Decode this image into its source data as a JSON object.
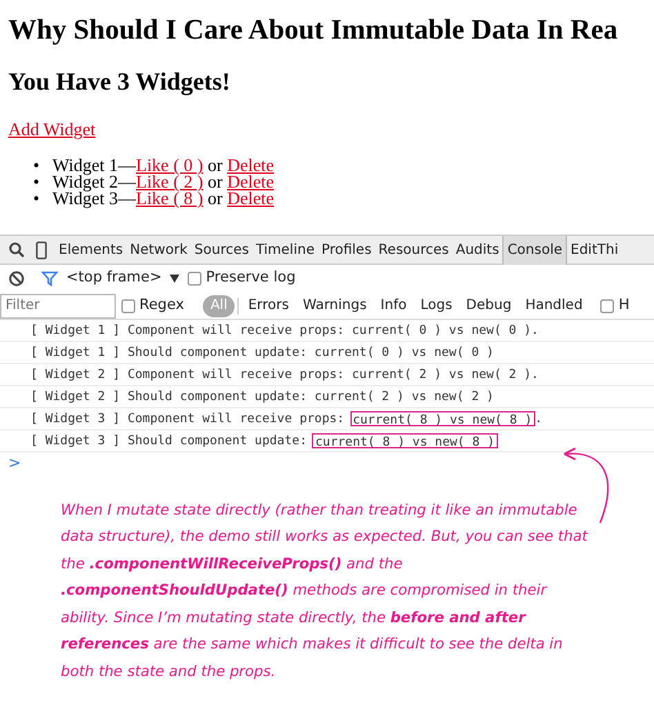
{
  "page": {
    "title": "Why Should I Care About Immutable Data In Rea",
    "subtitle": "You Have 3 Widgets!",
    "add_link": "Add Widget",
    "widgets": [
      {
        "marker": "•",
        "name": "Widget 1",
        "dash": "—",
        "like": "Like ( 0 )",
        "or": "or",
        "delete": "Delete"
      },
      {
        "marker": "•",
        "name": "Widget 2",
        "dash": "—",
        "like": "Like ( 2 )",
        "or": "or",
        "delete": "Delete"
      },
      {
        "marker": "•",
        "name": "Widget 3",
        "dash": "—",
        "like": "Like ( 8 )",
        "or": "or",
        "delete": "Delete"
      }
    ]
  },
  "devtools": {
    "tabs": [
      {
        "label": "Elements",
        "selected": false
      },
      {
        "label": "Network",
        "selected": false
      },
      {
        "label": "Sources",
        "selected": false
      },
      {
        "label": "Timeline",
        "selected": false
      },
      {
        "label": "Profiles",
        "selected": false
      },
      {
        "label": "Resources",
        "selected": false
      },
      {
        "label": "Audits",
        "selected": false
      },
      {
        "label": "Console",
        "selected": true
      },
      {
        "label": "EditThi",
        "selected": false
      }
    ],
    "frame_select": "<top frame>",
    "preserve_log": {
      "label": "Preserve log",
      "checked": false
    },
    "filter": {
      "placeholder": "Filter"
    },
    "regex": {
      "label": "Regex",
      "checked": false
    },
    "levels": [
      {
        "label": "All",
        "selected": true
      },
      {
        "label": "Errors",
        "selected": false
      },
      {
        "label": "Warnings",
        "selected": false
      },
      {
        "label": "Info",
        "selected": false
      },
      {
        "label": "Logs",
        "selected": false
      },
      {
        "label": "Debug",
        "selected": false
      },
      {
        "label": "Handled",
        "selected": false
      }
    ],
    "hidden_option": {
      "label": "H",
      "checked": false
    },
    "log": [
      {
        "parts": [
          {
            "text": "[ Widget 1 ] Component will receive props: current( 0 ) vs new( 0 ).",
            "boxed": false
          }
        ]
      },
      {
        "parts": [
          {
            "text": "[ Widget 1 ] Should component update: current( 0 ) vs new( 0 )",
            "boxed": false
          }
        ]
      },
      {
        "parts": [
          {
            "text": "[ Widget 2 ] Component will receive props: current( 2 ) vs new( 2 ).",
            "boxed": false
          }
        ]
      },
      {
        "parts": [
          {
            "text": "[ Widget 2 ] Should component update: current( 2 ) vs new( 2 )",
            "boxed": false
          }
        ]
      },
      {
        "parts": [
          {
            "text": "[ Widget 3 ] Component will receive props:",
            "boxed": false
          },
          {
            "text": "current( 8 ) vs new( 8 )",
            "boxed": true
          },
          {
            "text": ".",
            "boxed": false
          }
        ]
      },
      {
        "parts": [
          {
            "text": "[ Widget 3 ] Should component update:",
            "boxed": false
          },
          {
            "text": "current( 8 ) vs new( 8 )",
            "boxed": true
          }
        ]
      }
    ],
    "prompt": ">"
  },
  "annotation": "When I mutate state directly (rather than treating it like an immutable data structure), the demo still works as expected. But, you can see that the **.componentWillReceiveProps()** and the **.componentShouldUpdate()** methods are compromised in their ability. Since I’m mutating state directly, the **before and after references** are the same which makes it difficult to see the delta in both the state and the props."
}
